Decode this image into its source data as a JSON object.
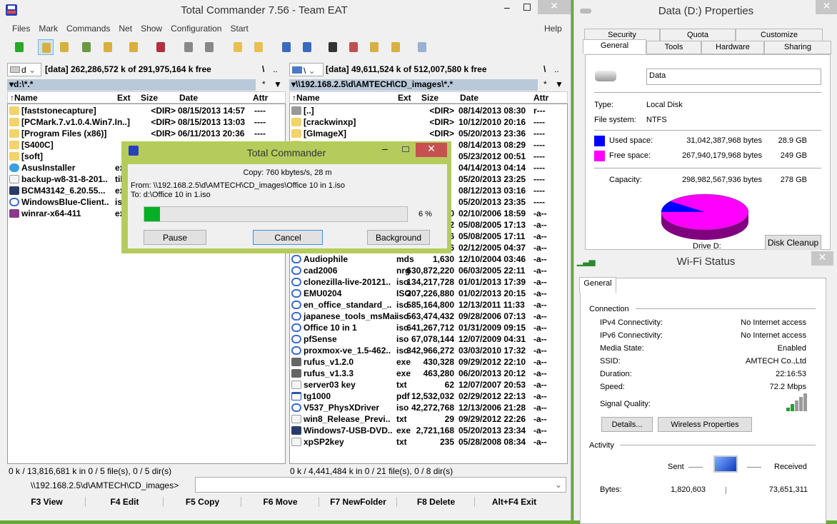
{
  "tc": {
    "title": "Total Commander 7.56 - Team EAT",
    "menu": [
      "Files",
      "Mark",
      "Commands",
      "Net",
      "Show",
      "Configuration",
      "Start"
    ],
    "help": "Help",
    "left": {
      "drive": "d",
      "info": "[data]  262,286,572 k of 291,975,164 k free",
      "root": "\\",
      "up": "..",
      "path": "d:\\*.*",
      "filter": "*",
      "status": "0 k / 13,816,681 k in 0 / 5 file(s), 0 / 5 dir(s)"
    },
    "right": {
      "drive": "\\",
      "info": "[data]  49,611,524 k of 512,007,580 k free",
      "root": "\\",
      "up": "..",
      "path": "\\\\192.168.2.5\\d\\AMTECH\\CD_images\\*.*",
      "filter": "*",
      "status": "0 k / 4,441,484 k in 0 / 21 file(s), 0 / 8 dir(s)"
    },
    "columns": {
      "name": "Name",
      "ext": "Ext",
      "size": "Size",
      "date": "Date",
      "attr": "Attr"
    },
    "left_files": [
      {
        "name": "[faststonecapture]",
        "ext": "",
        "size": "<DIR>",
        "date": "08/15/2013 14:57",
        "attr": "----",
        "icon": "folder"
      },
      {
        "name": "[PCMark.7.v1.0.4.Win7.In..]",
        "ext": "",
        "size": "<DIR>",
        "date": "08/15/2013 13:03",
        "attr": "----",
        "icon": "folder"
      },
      {
        "name": "[Program Files (x86)]",
        "ext": "",
        "size": "<DIR>",
        "date": "06/11/2013 20:36",
        "attr": "----",
        "icon": "folder"
      },
      {
        "name": "[S400C]",
        "ext": "",
        "size": "",
        "date": "",
        "attr": "",
        "icon": "folder"
      },
      {
        "name": "[soft]",
        "ext": "",
        "size": "",
        "date": "",
        "attr": "",
        "icon": "folder"
      },
      {
        "name": "AsusInstaller",
        "ext": "ex",
        "size": "",
        "date": "",
        "attr": "",
        "icon": "installer"
      },
      {
        "name": "backup-w8-31-8-201..",
        "ext": "tib",
        "size": "",
        "date": "",
        "attr": "",
        "icon": "file"
      },
      {
        "name": "BCM43142_6.20.55...",
        "ext": "ex",
        "size": "",
        "date": "",
        "attr": "",
        "icon": "app"
      },
      {
        "name": "WindowsBlue-Client..",
        "ext": "is",
        "size": "",
        "date": "",
        "attr": "",
        "icon": "disc"
      },
      {
        "name": "winrar-x64-411",
        "ext": "ex",
        "size": "",
        "date": "",
        "attr": "",
        "icon": "winrar"
      }
    ],
    "right_files": [
      {
        "name": "[..]",
        "ext": "",
        "size": "<DIR>",
        "date": "08/14/2013 08:30",
        "attr": "r---",
        "icon": "up"
      },
      {
        "name": "[crackwinxp]",
        "ext": "",
        "size": "<DIR>",
        "date": "10/12/2010 20:16",
        "attr": "----",
        "icon": "folder"
      },
      {
        "name": "[GImageX]",
        "ext": "",
        "size": "<DIR>",
        "date": "05/20/2013 23:36",
        "attr": "----",
        "icon": "folder"
      },
      {
        "name": "",
        "ext": "",
        "size": "",
        "date": "08/14/2013 08:29",
        "attr": "----",
        "icon": "folder"
      },
      {
        "name": "",
        "ext": "",
        "size": "",
        "date": "05/23/2012 00:51",
        "attr": "----",
        "icon": "folder"
      },
      {
        "name": "",
        "ext": "",
        "size": "",
        "date": "04/14/2013 04:14",
        "attr": "----",
        "icon": "folder"
      },
      {
        "name": "",
        "ext": "",
        "size": "",
        "date": "05/20/2013 23:25",
        "attr": "----",
        "icon": "folder"
      },
      {
        "name": "",
        "ext": "",
        "size": "",
        "date": "08/12/2013 03:16",
        "attr": "----",
        "icon": "folder"
      },
      {
        "name": "",
        "ext": "",
        "size": "",
        "date": "05/20/2013 23:35",
        "attr": "----",
        "icon": "folder"
      },
      {
        "name": "",
        "ext": "",
        "size": "0",
        "date": "02/10/2006 18:59",
        "attr": "-a--",
        "icon": "disc"
      },
      {
        "name": "",
        "ext": "",
        "size": "2",
        "date": "05/08/2005 17:13",
        "attr": "-a--",
        "icon": "disc"
      },
      {
        "name": "",
        "ext": "",
        "size": "6",
        "date": "05/08/2005 17:11",
        "attr": "-a--",
        "icon": "disc"
      },
      {
        "name": "",
        "ext": "",
        "size": "6",
        "date": "02/12/2005 04:37",
        "attr": "-a--",
        "icon": "disc"
      },
      {
        "name": "Audiophile",
        "ext": "mds",
        "size": "1,630",
        "date": "12/10/2004 03:46",
        "attr": "-a--",
        "icon": "disc"
      },
      {
        "name": "cad2006",
        "ext": "nrg",
        "size": "630,872,220",
        "date": "06/03/2005 22:11",
        "attr": "-a--",
        "icon": "disc"
      },
      {
        "name": "clonezilla-live-20121..",
        "ext": "iso",
        "size": "134,217,728",
        "date": "01/01/2013 17:39",
        "attr": "-a--",
        "icon": "disc"
      },
      {
        "name": "EMU0204",
        "ext": "ISO",
        "size": "207,226,880",
        "date": "01/02/2013 20:15",
        "attr": "-a--",
        "icon": "disc"
      },
      {
        "name": "en_office_standard_..",
        "ext": "iso",
        "size": "585,164,800",
        "date": "12/13/2011 11:33",
        "attr": "-a--",
        "icon": "disc"
      },
      {
        "name": "japanese_tools_msMai",
        "ext": "iso",
        "size": "563,474,432",
        "date": "09/28/2006 07:13",
        "attr": "-a--",
        "icon": "disc"
      },
      {
        "name": "Office 10 in 1",
        "ext": "iso",
        "size": "641,267,712",
        "date": "01/31/2009 09:15",
        "attr": "-a--",
        "icon": "disc"
      },
      {
        "name": "pfSense",
        "ext": "iso",
        "size": "67,078,144",
        "date": "12/07/2009 04:31",
        "attr": "-a--",
        "icon": "disc"
      },
      {
        "name": "proxmox-ve_1.5-462..",
        "ext": "iso",
        "size": "342,966,272",
        "date": "03/03/2010 17:32",
        "attr": "-a--",
        "icon": "disc"
      },
      {
        "name": "rufus_v1.2.0",
        "ext": "exe",
        "size": "430,328",
        "date": "09/29/2012 22:10",
        "attr": "-a--",
        "icon": "usb"
      },
      {
        "name": "rufus_v1.3.3",
        "ext": "exe",
        "size": "463,280",
        "date": "06/20/2013 20:12",
        "attr": "-a--",
        "icon": "usb"
      },
      {
        "name": "server03 key",
        "ext": "txt",
        "size": "62",
        "date": "12/07/2007 20:53",
        "attr": "-a--",
        "icon": "file"
      },
      {
        "name": "tg1000",
        "ext": "pdf",
        "size": "12,532,032",
        "date": "02/29/2012 22:13",
        "attr": "-a--",
        "icon": "window"
      },
      {
        "name": "V537_PhysXDriver",
        "ext": "iso",
        "size": "42,272,768",
        "date": "12/13/2006 21:28",
        "attr": "-a--",
        "icon": "disc"
      },
      {
        "name": "win8_Release_Previ..",
        "ext": "txt",
        "size": "29",
        "date": "09/29/2012 22:26",
        "attr": "-a--",
        "icon": "file"
      },
      {
        "name": "Windows7-USB-DVD..",
        "ext": "exe",
        "size": "2,721,168",
        "date": "05/20/2013 23:34",
        "attr": "-a--",
        "icon": "app"
      },
      {
        "name": "xpSP2key",
        "ext": "txt",
        "size": "235",
        "date": "05/28/2008 08:34",
        "attr": "-a--",
        "icon": "file"
      }
    ],
    "cmdline": {
      "prompt": "\\\\192.168.2.5\\d\\AMTECH\\CD_images>",
      "value": ""
    },
    "fkeys": [
      "F3 View",
      "F4 Edit",
      "F5 Copy",
      "F6 Move",
      "F7 NewFolder",
      "F8 Delete",
      "Alt+F4 Exit"
    ]
  },
  "copy_dialog": {
    "title": "Total Commander",
    "speed": "Copy: 760 kbytes/s, 28 m",
    "from": "From: \\\\192.168.2.5\\d\\AMTECH\\CD_images\\Office 10 in 1.iso",
    "to": "To:  d:\\Office 10 in 1.iso",
    "progress_percent": 6,
    "progress_label": "6 %",
    "pause": "Pause",
    "cancel": "Cancel",
    "background": "Background",
    "progress_color": "#06b025"
  },
  "props": {
    "title": "Data (D:) Properties",
    "tabs_top": [
      "Security",
      "Quota",
      "Customize"
    ],
    "tabs_bottom": [
      "General",
      "Tools",
      "Hardware",
      "Sharing"
    ],
    "name_value": "Data",
    "type_label": "Type:",
    "type": "Local Disk",
    "fs_label": "File system:",
    "fs": "NTFS",
    "used_label": "Used space:",
    "used_bytes": "31,042,387,968 bytes",
    "used_gb": "28.9 GB",
    "free_label": "Free space:",
    "free_bytes": "267,940,179,968 bytes",
    "free_gb": "249 GB",
    "cap_label": "Capacity:",
    "cap_bytes": "298,982,567,936 bytes",
    "cap_gb": "278 GB",
    "drive_label": "Drive D:",
    "cleanup": "Disk Cleanup",
    "used_color": "#0000ff",
    "free_color": "#ff00ff",
    "used_fraction": 0.1038
  },
  "wifi": {
    "title": "Wi-Fi Status",
    "tab": "General",
    "connection": "Connection",
    "rows": [
      {
        "k": "IPv4 Connectivity:",
        "v": "No Internet access"
      },
      {
        "k": "IPv6 Connectivity:",
        "v": "No Internet access"
      },
      {
        "k": "Media State:",
        "v": "Enabled"
      },
      {
        "k": "SSID:",
        "v": "AMTECH Co.,Ltd"
      },
      {
        "k": "Duration:",
        "v": "22:16:53"
      },
      {
        "k": "Speed:",
        "v": "72.2 Mbps"
      }
    ],
    "signal_label": "Signal Quality:",
    "signal_bars": 2,
    "details": "Details...",
    "wireless": "Wireless Properties",
    "activity": "Activity",
    "sent": "Sent",
    "received": "Received",
    "bytes_label": "Bytes:",
    "sent_bytes": "1,820,603",
    "recv_bytes": "73,651,311"
  }
}
